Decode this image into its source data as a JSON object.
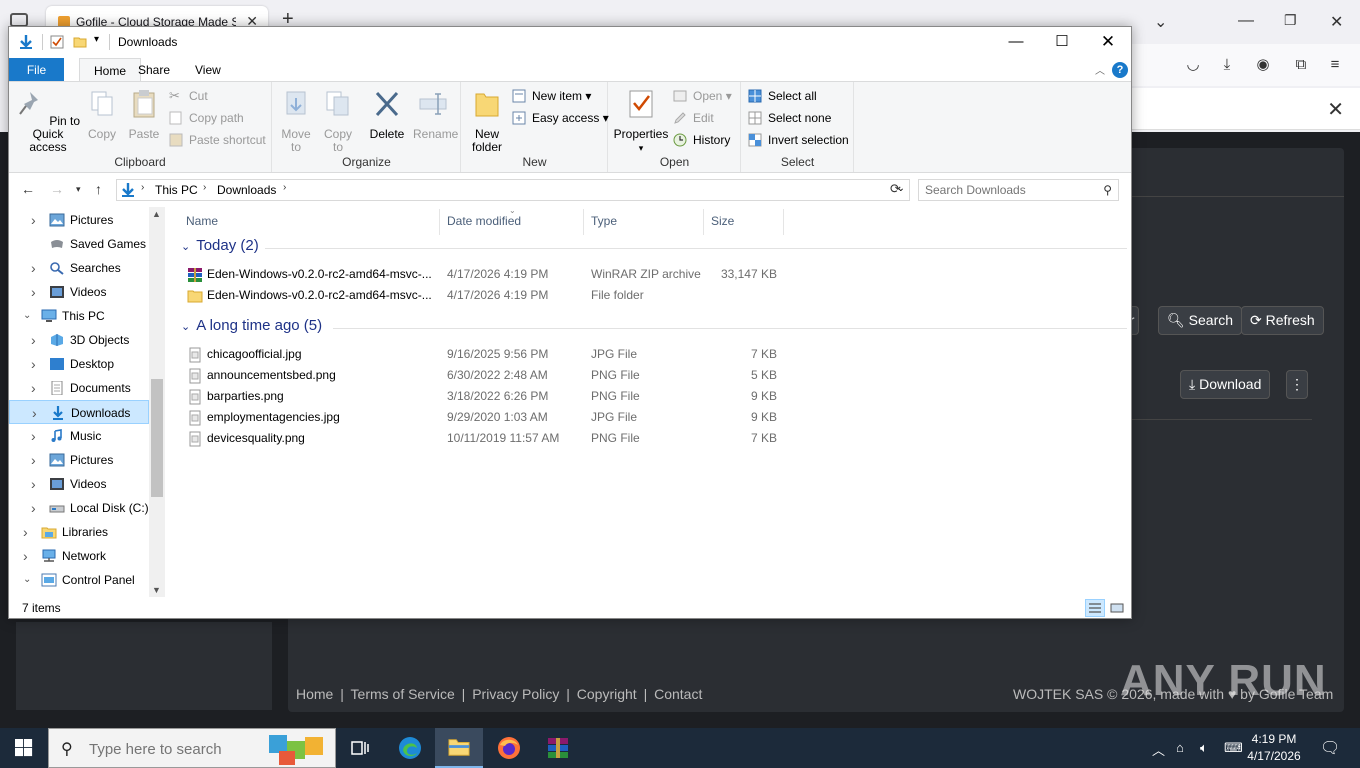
{
  "browser": {
    "tab_title": "Gofile - Cloud Storage Made Simple",
    "site": {
      "buttons": {
        "filter_partial": "er",
        "search": "Search",
        "refresh": "Refresh",
        "download": "Download"
      },
      "footer_links": [
        "Home",
        "Terms of Service",
        "Privacy Policy",
        "Copyright",
        "Contact"
      ],
      "footer_sep": "|",
      "copyright": "WOJTEK SAS © 2026, made with ♥ by Gofile Team"
    }
  },
  "watermark": "ANY RUN",
  "explorer": {
    "title": "Downloads",
    "tabs": {
      "file": "File",
      "home": "Home",
      "share": "Share",
      "view": "View"
    },
    "help_glyph": "?",
    "ribbon": {
      "clipboard": {
        "label": "Clipboard",
        "pin": "Pin to Quick access",
        "copy": "Copy",
        "paste": "Paste",
        "cut": "Cut",
        "copy_path": "Copy path",
        "paste_shortcut": "Paste shortcut"
      },
      "organize": {
        "label": "Organize",
        "move_to": "Move to",
        "copy_to": "Copy to",
        "delete": "Delete",
        "rename": "Rename"
      },
      "new": {
        "label": "New",
        "new_folder": "New folder",
        "new_item": "New item",
        "easy_access": "Easy access"
      },
      "open": {
        "label": "Open",
        "properties": "Properties",
        "open": "Open",
        "edit": "Edit",
        "history": "History"
      },
      "select": {
        "label": "Select",
        "select_all": "Select all",
        "select_none": "Select none",
        "invert": "Invert selection"
      }
    },
    "address": {
      "crumbs": [
        "This PC",
        "Downloads"
      ]
    },
    "search_placeholder": "Search Downloads",
    "nav": [
      {
        "label": "Pictures",
        "indent": 1,
        "expander": true,
        "icon": "pictures"
      },
      {
        "label": "Saved Games",
        "indent": 1,
        "expander": false,
        "icon": "saved-games"
      },
      {
        "label": "Searches",
        "indent": 1,
        "expander": true,
        "icon": "searches"
      },
      {
        "label": "Videos",
        "indent": 1,
        "expander": true,
        "icon": "videos"
      },
      {
        "label": "This PC",
        "indent": 0,
        "expander": "open",
        "icon": "this-pc"
      },
      {
        "label": "3D Objects",
        "indent": 1,
        "expander": true,
        "icon": "3d-objects"
      },
      {
        "label": "Desktop",
        "indent": 1,
        "expander": true,
        "icon": "desktop"
      },
      {
        "label": "Documents",
        "indent": 1,
        "expander": true,
        "icon": "documents"
      },
      {
        "label": "Downloads",
        "indent": 1,
        "expander": true,
        "icon": "downloads",
        "selected": true
      },
      {
        "label": "Music",
        "indent": 1,
        "expander": true,
        "icon": "music"
      },
      {
        "label": "Pictures",
        "indent": 1,
        "expander": true,
        "icon": "pictures"
      },
      {
        "label": "Videos",
        "indent": 1,
        "expander": true,
        "icon": "videos"
      },
      {
        "label": "Local Disk (C:)",
        "indent": 1,
        "expander": true,
        "icon": "local-disk"
      },
      {
        "label": "Libraries",
        "indent": 0,
        "expander": true,
        "icon": "libraries"
      },
      {
        "label": "Network",
        "indent": 0,
        "expander": true,
        "icon": "network"
      },
      {
        "label": "Control Panel",
        "indent": 0,
        "expander": "open",
        "icon": "control-panel"
      }
    ],
    "columns": {
      "name": "Name",
      "date": "Date modified",
      "type": "Type",
      "size": "Size"
    },
    "groups": [
      {
        "title": "Today (2)",
        "files": [
          {
            "name": "Eden-Windows-v0.2.0-rc2-amd64-msvc-...",
            "date": "4/17/2026 4:19 PM",
            "type": "WinRAR ZIP archive",
            "size": "33,147 KB",
            "icon": "winrar"
          },
          {
            "name": "Eden-Windows-v0.2.0-rc2-amd64-msvc-...",
            "date": "4/17/2026 4:19 PM",
            "type": "File folder",
            "size": "",
            "icon": "folder"
          }
        ]
      },
      {
        "title": "A long time ago (5)",
        "files": [
          {
            "name": "chicagoofficial.jpg",
            "date": "9/16/2025 9:56 PM",
            "type": "JPG File",
            "size": "7 KB",
            "icon": "image"
          },
          {
            "name": "announcementsbed.png",
            "date": "6/30/2022 2:48 AM",
            "type": "PNG File",
            "size": "5 KB",
            "icon": "image"
          },
          {
            "name": "barparties.png",
            "date": "3/18/2022 6:26 PM",
            "type": "PNG File",
            "size": "9 KB",
            "icon": "image"
          },
          {
            "name": "employmentagencies.jpg",
            "date": "9/29/2020 1:03 AM",
            "type": "JPG File",
            "size": "9 KB",
            "icon": "image"
          },
          {
            "name": "devicesquality.png",
            "date": "10/11/2019 11:57 AM",
            "type": "PNG File",
            "size": "7 KB",
            "icon": "image"
          }
        ]
      }
    ],
    "status": "7 items"
  },
  "taskbar": {
    "search_placeholder": "Type here to search",
    "apps": [
      "task-view",
      "edge",
      "file-explorer",
      "firefox",
      "winrar"
    ],
    "active_app": "file-explorer",
    "time": "4:19 PM",
    "date": "4/17/2026"
  },
  "colors": {
    "accent": "#1979ca",
    "selection": "#cce8ff",
    "taskbar": "#1c2a3a",
    "site_bg": "#1d1f23"
  }
}
